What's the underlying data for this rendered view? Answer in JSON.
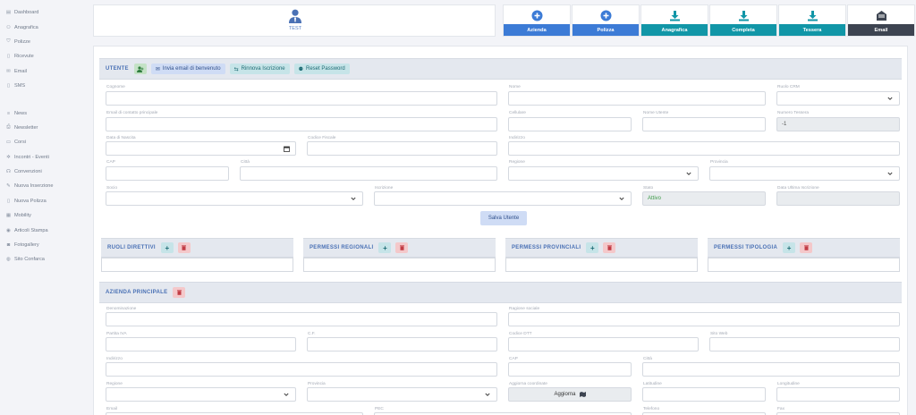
{
  "sidebar": {
    "group1": [
      {
        "label": "Dashboard",
        "icon": "dashboard-icon",
        "glyph": "▤"
      },
      {
        "label": "Anagrafica",
        "icon": "person-icon",
        "glyph": "⚇"
      },
      {
        "label": "Polizze",
        "icon": "shield-icon",
        "glyph": "⛉"
      },
      {
        "label": "Ricevute",
        "icon": "receipt-icon",
        "glyph": "▯"
      },
      {
        "label": "Email",
        "icon": "mail-icon",
        "glyph": "✉"
      },
      {
        "label": "SMS",
        "icon": "phone-icon",
        "glyph": "▯"
      }
    ],
    "group2": [
      {
        "label": "News",
        "icon": "news-icon",
        "glyph": "≡"
      },
      {
        "label": "Newsletter",
        "icon": "newsletter-icon",
        "glyph": "⎙"
      },
      {
        "label": "Corsi",
        "icon": "monitor-icon",
        "glyph": "▭"
      },
      {
        "label": "Incontri - Eventi",
        "icon": "events-icon",
        "glyph": "✲"
      },
      {
        "label": "Convenzioni",
        "icon": "handshake-icon",
        "glyph": "☊"
      },
      {
        "label": "Nuova Inserzione",
        "icon": "edit-icon",
        "glyph": "✎"
      },
      {
        "label": "Nuova Polizza",
        "icon": "document-icon",
        "glyph": "▯"
      },
      {
        "label": "Mobility",
        "icon": "grid-icon",
        "glyph": "▦"
      },
      {
        "label": "Articoli Stampa",
        "icon": "eye-icon",
        "glyph": "◉"
      },
      {
        "label": "Fotogallery",
        "icon": "camera-icon",
        "glyph": "◙"
      },
      {
        "label": "Sito Confarca",
        "icon": "globe-icon",
        "glyph": "◍"
      }
    ]
  },
  "header": {
    "user_name": "TEST",
    "actions": [
      {
        "label": "Azienda",
        "icon": "plus-circle-icon",
        "color": "#3c7bd6"
      },
      {
        "label": "Polizza",
        "icon": "plus-circle-icon",
        "color": "#3c7bd6"
      },
      {
        "label": "Anagrafica",
        "icon": "download-icon",
        "color": "#1196a7"
      },
      {
        "label": "Completa",
        "icon": "download-icon",
        "color": "#1196a7"
      },
      {
        "label": "Tessera",
        "icon": "download-icon",
        "color": "#1196a7"
      },
      {
        "label": "Email",
        "icon": "mail-open-icon",
        "color": "#3d4451"
      }
    ]
  },
  "utente": {
    "title": "UTENTE",
    "btn_welcome": "Invia email di benvenuto",
    "btn_renew": "Rinnova Iscrizione",
    "btn_reset": "Reset Password",
    "labels": {
      "cognome": "Cognome",
      "nome": "Nome",
      "ruolo_crm": "Ruolo CRM",
      "email": "Email di contatto principale",
      "cellulare": "Cellulare",
      "nome_utente": "Nome Utente",
      "numero_tessera": "Numero Tessera",
      "data_nascita": "Data di Nascita",
      "codice_fiscale": "Codice Fiscale",
      "indirizzo": "Indirizzo",
      "cap": "CAP",
      "citta": "Città",
      "regione": "Regione",
      "provincia": "Provincia",
      "socio": "Socio",
      "iscrizione": "Iscrizione",
      "stato": "Stato",
      "data_ultima": "Data Ultima Iscrizione"
    },
    "values": {
      "numero_tessera": "-1",
      "stato": "Attivo"
    },
    "save_label": "Salva Utente"
  },
  "panels": [
    {
      "title": "RUOLI DIRETTIVI"
    },
    {
      "title": "PERMESSI REGIONALI"
    },
    {
      "title": "PERMESSI PROVINCIALI"
    },
    {
      "title": "PERMESSI TIPOLOGIA"
    }
  ],
  "azienda": {
    "title": "AZIENDA PRINCIPALE",
    "labels": {
      "denominazione": "Denominazione",
      "ragione_sociale": "Ragione sociale",
      "partita_iva": "Partita IVA",
      "cf": "C.F.",
      "codice_dtt": "Codice DTT",
      "sito_web": "Sito Web",
      "indirizzo": "Indirizzo",
      "cap": "CAP",
      "citta": "Città",
      "regione": "Regione",
      "provincia": "Provincia",
      "aggiorna_coord": "Aggiorna coordinate",
      "latitudine": "Latitudine",
      "longitudine": "Longitudine",
      "email": "Email",
      "pec": "PEC",
      "telefono": "Telefono",
      "fax": "Fax"
    },
    "aggiorna_label": "Aggiorna"
  }
}
